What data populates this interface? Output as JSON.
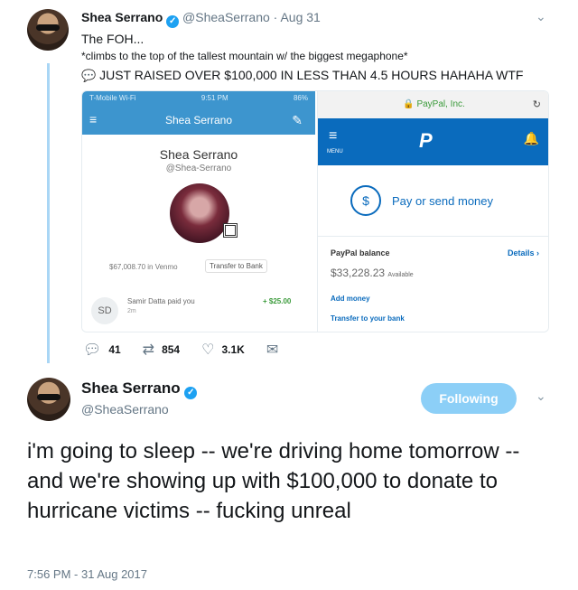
{
  "tweet1": {
    "name": "Shea Serrano",
    "handle": "@SheaSerrano",
    "separator": "·",
    "date": "Aug 31",
    "lines": [
      "The FOH...",
      "*climbs to the top of the tallest mountain w/ the biggest megaphone*",
      "JUST RAISED OVER $100,000 IN LESS THAN 4.5 HOURS HAHAHA WTF"
    ],
    "media": {
      "venmo": {
        "status_left": "T-Mobile Wi-Fi",
        "status_time": "9:51 PM",
        "status_battery": "86%",
        "title": "Shea Serrano",
        "profile_name": "Shea Serrano",
        "profile_handle": "@Shea-Serrano",
        "balance_text": "$67,008.70 in Venmo",
        "transfer_label": "Transfer to Bank",
        "payer_initials": "SD",
        "payment_text": "Samir Datta paid you",
        "payment_time": "2m",
        "payment_amount": "+ $25.00"
      },
      "paypal": {
        "url": "PayPal, Inc.",
        "menu_label": "MENU",
        "logo": "P",
        "send_label": "Pay or send money",
        "balance_title": "PayPal balance",
        "details_label": "Details",
        "balance_amount": "$33,228.23",
        "available_label": "Available",
        "add_money": "Add money",
        "transfer_bank": "Transfer to your bank"
      }
    },
    "actions": {
      "replies": "41",
      "retweets": "854",
      "likes": "3.1K"
    }
  },
  "tweet2": {
    "name": "Shea Serrano",
    "handle": "@SheaSerrano",
    "follow_label": "Following",
    "text": "i'm going to sleep -- we're driving home tomorrow -- and we're showing up with $100,000 to donate to hurricane victims -- fucking unreal",
    "timestamp": "7:56 PM - 31 Aug 2017"
  },
  "colors": {
    "twitter_blue": "#1da1f2",
    "following_button": "#8ccff7",
    "venmo_blue": "#3d95ce",
    "paypal_blue": "#0a6bbd"
  }
}
